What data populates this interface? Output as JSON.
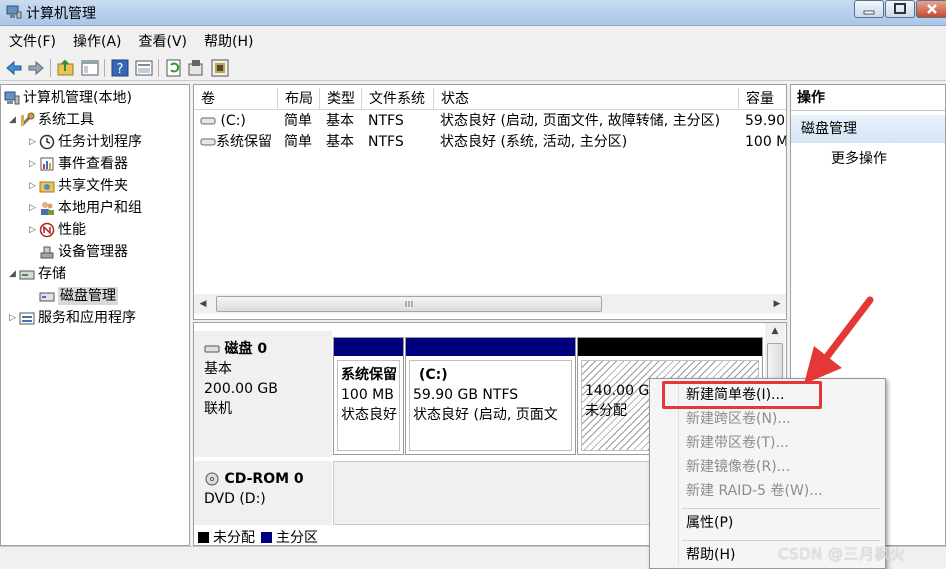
{
  "window": {
    "title": "计算机管理"
  },
  "menu": [
    "文件(F)",
    "操作(A)",
    "查看(V)",
    "帮助(H)"
  ],
  "toolbar_icons": [
    "back-icon",
    "forward-icon",
    "up-folder-icon",
    "show-tree-icon",
    "help-icon",
    "properties-icon",
    "refresh-icon",
    "settings-icon",
    "export-icon"
  ],
  "tree": {
    "root": "计算机管理(本地)",
    "system_tools": "系统工具",
    "task_scheduler": "任务计划程序",
    "event_viewer": "事件查看器",
    "shared_folders": "共享文件夹",
    "local_users": "本地用户和组",
    "performance": "性能",
    "device_manager": "设备管理器",
    "storage": "存储",
    "disk_management": "磁盘管理",
    "services_apps": "服务和应用程序"
  },
  "volume_table": {
    "headers": [
      "卷",
      "布局",
      "类型",
      "文件系统",
      "状态",
      "容量"
    ],
    "rows": [
      [
        "(C:)",
        "简单",
        "基本",
        "NTFS",
        "状态良好 (启动, 页面文件, 故障转储, 主分区)",
        "59.90"
      ],
      [
        "系统保留",
        "简单",
        "基本",
        "NTFS",
        "状态良好 (系统, 活动, 主分区)",
        "100 M"
      ]
    ]
  },
  "disks": {
    "disk0": {
      "title": "磁盘 0",
      "type": "基本",
      "size": "200.00 GB",
      "status": "联机"
    },
    "cdrom0": {
      "title": "CD-ROM 0",
      "drive": "DVD (D:)"
    }
  },
  "partitions": {
    "system_reserved": {
      "name": "系统保留",
      "size": "100 MB",
      "status": "状态良好"
    },
    "c_drive": {
      "name": "(C:)",
      "size": "59.90 GB NTFS",
      "status": "状态良好 (启动, 页面文"
    },
    "unallocated": {
      "size": "140.00 G",
      "status": "未分配"
    }
  },
  "legend": {
    "unallocated": "未分配",
    "primary": "主分区"
  },
  "actions": {
    "header": "操作",
    "section": "磁盘管理",
    "more": "更多操作"
  },
  "context_menu": {
    "new_simple": "新建简单卷(I)...",
    "new_spanned": "新建跨区卷(N)...",
    "new_striped": "新建带区卷(T)...",
    "new_mirrored": "新建镜像卷(R)...",
    "new_raid5": "新建 RAID-5 卷(W)...",
    "properties": "属性(P)",
    "help": "帮助(H)"
  },
  "colors": {
    "primary_partition": "#00007f",
    "unallocated": "#000000",
    "highlight": "#e43737",
    "selection": "#d9d9d9"
  },
  "watermark": "CSDN @三月枫火"
}
